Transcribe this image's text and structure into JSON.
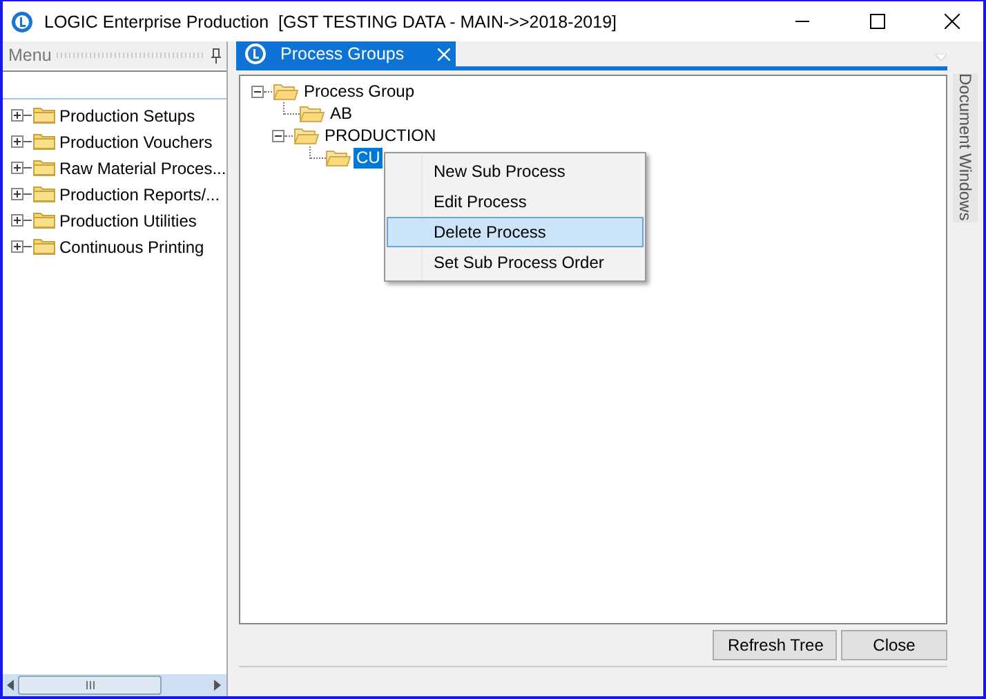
{
  "window": {
    "title": "LOGIC Enterprise Production  [GST TESTING DATA - MAIN->>2018-2019]"
  },
  "menu_panel": {
    "title": "Menu",
    "items": [
      {
        "label": "Production Setups",
        "expanded": false
      },
      {
        "label": "Production Vouchers",
        "expanded": false
      },
      {
        "label": "Raw  Material  Proces...",
        "expanded": false
      },
      {
        "label": "Production  Reports/...",
        "expanded": false
      },
      {
        "label": "Production Utilities",
        "expanded": false
      },
      {
        "label": "Continuous Printing",
        "expanded": false
      }
    ]
  },
  "tabs": [
    {
      "label": "Process Groups",
      "selected": true
    }
  ],
  "side_tab": {
    "label": "Document Windows"
  },
  "tree": [
    {
      "label": "Process Group",
      "expanded": true,
      "selected": false,
      "children": [
        {
          "label": "AB",
          "selected": false
        },
        {
          "label": "PRODUCTION",
          "expanded": true,
          "selected": false,
          "children": [
            {
              "label": "CU",
              "selected": true
            }
          ]
        }
      ]
    }
  ],
  "context_menu": [
    {
      "label": "New Sub Process",
      "selected": false
    },
    {
      "label": "Edit Process",
      "selected": false
    },
    {
      "label": "Delete Process",
      "selected": true
    },
    {
      "label": "Set Sub Process Order",
      "selected": false
    }
  ],
  "buttons": [
    "Refresh Tree",
    "Close"
  ]
}
